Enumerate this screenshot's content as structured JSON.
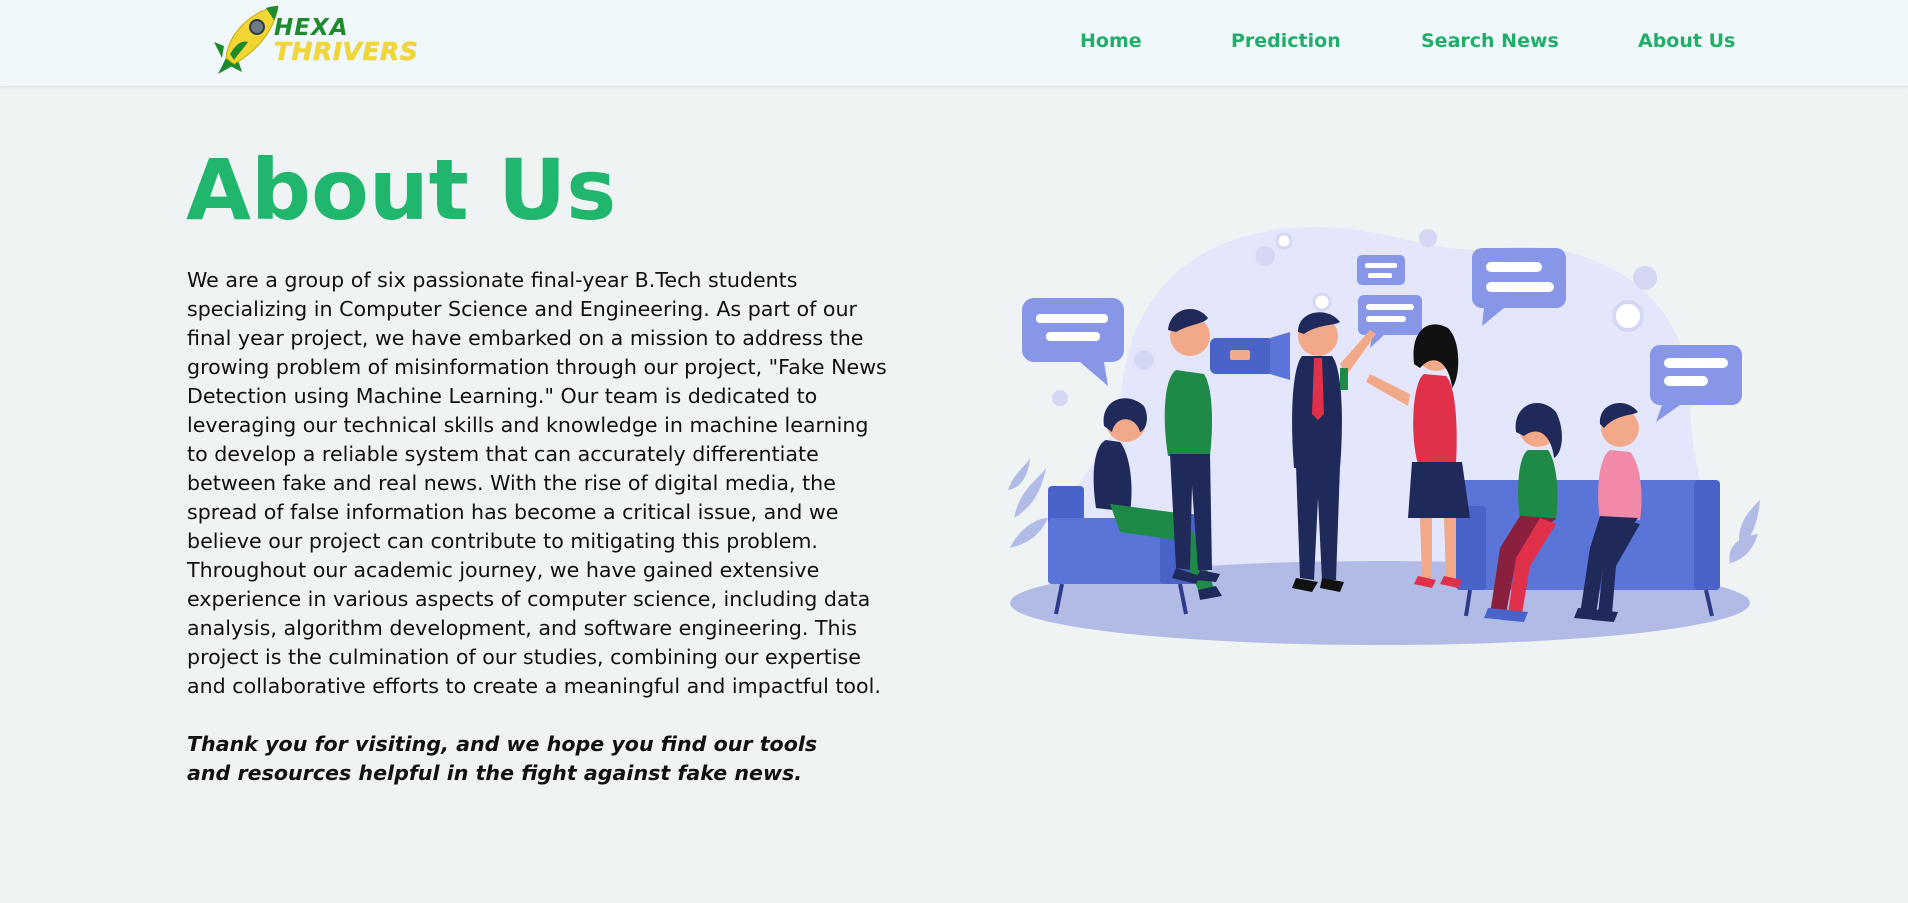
{
  "brand": {
    "line1": "HEXA",
    "line2": "THRIVERS",
    "icon": "rocket-icon",
    "colors": {
      "green": "#1f8a2d",
      "yellow": "#f2d633"
    }
  },
  "nav": {
    "items": [
      {
        "label": "Home"
      },
      {
        "label": "Prediction"
      },
      {
        "label": "Search News"
      },
      {
        "label": "About Us"
      }
    ],
    "color": "#21ae68"
  },
  "page": {
    "title": "About Us",
    "body": "We are a group of six passionate final-year B.Tech students specializing in Computer Science and Engineering. As part of our final year project, we have embarked on a mission to address the growing problem of misinformation through our project, \"Fake News Detection using Machine Learning.\" Our team is dedicated to leveraging our technical skills and knowledge in machine learning to develop a reliable system that can accurately differentiate between fake and real news. With the rise of digital media, the spread of false information has become a critical issue, and we believe our project can contribute to mitigating this problem. Throughout our academic journey, we have gained extensive experience in various aspects of computer science, including data analysis, algorithm development, and software engineering. This project is the culmination of our studies, combining our expertise and collaborative efforts to create a meaningful and impactful tool.",
    "closing": "Thank you for visiting, and we hope you find our tools and resources helpful in the fight against fake news.",
    "accent_color": "#21b66e",
    "illustration": "news-interview-illustration"
  }
}
